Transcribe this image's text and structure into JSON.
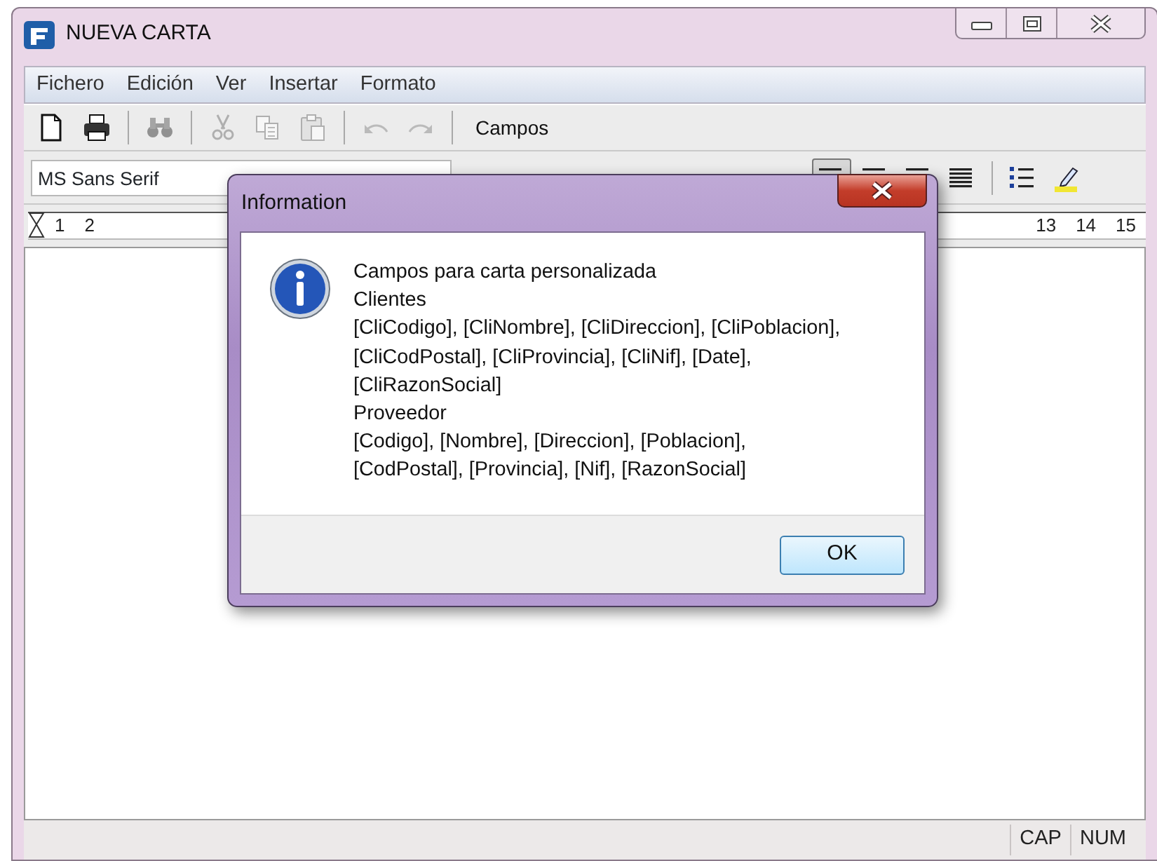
{
  "window": {
    "title": "NUEVA CARTA",
    "controls": [
      {
        "kind": "minimize"
      },
      {
        "kind": "maximize"
      },
      {
        "kind": "close"
      }
    ]
  },
  "menu": [
    "Fichero",
    "Edición",
    "Ver",
    "Insertar",
    "Formato"
  ],
  "toolbar": [
    {
      "kind": "new",
      "disabled": false
    },
    {
      "kind": "print",
      "disabled": false
    },
    {
      "kind": "sep"
    },
    {
      "kind": "find",
      "disabled": true
    },
    {
      "kind": "sep"
    },
    {
      "kind": "cut",
      "disabled": true
    },
    {
      "kind": "copy",
      "disabled": true
    },
    {
      "kind": "paste",
      "disabled": true
    },
    {
      "kind": "sep"
    },
    {
      "kind": "undo",
      "disabled": true
    },
    {
      "kind": "redo",
      "disabled": true
    },
    {
      "kind": "sep"
    },
    {
      "kind": "text",
      "label": "Campos"
    }
  ],
  "format_bar": {
    "font": "MS Sans Serif",
    "tools": [
      {
        "kind": "align-left",
        "selected": true
      },
      {
        "kind": "align-center",
        "selected": false
      },
      {
        "kind": "align-right",
        "selected": false
      },
      {
        "kind": "justify",
        "selected": false
      },
      {
        "kind": "sep"
      },
      {
        "kind": "bullets",
        "selected": false
      },
      {
        "kind": "highlight",
        "selected": false
      }
    ]
  },
  "ruler": {
    "left_numbers": [
      "1",
      "2"
    ],
    "right_numbers": [
      "13",
      "14",
      "15"
    ]
  },
  "status_bar": [
    "CAP",
    "NUM"
  ],
  "dialog": {
    "title": "Information",
    "lines": [
      "Campos para carta personalizada",
      "Clientes",
      "[CliCodigo], [CliNombre], [CliDireccion], [CliPoblacion],",
      "[CliCodPostal], [CliProvincia], [CliNif], [Date],",
      "[CliRazonSocial]",
      "Proveedor",
      "[Codigo], [Nombre], [Direccion], [Poblacion],",
      "[CodPostal], [Provincia], [Nif], [RazonSocial]"
    ],
    "button": "OK"
  }
}
